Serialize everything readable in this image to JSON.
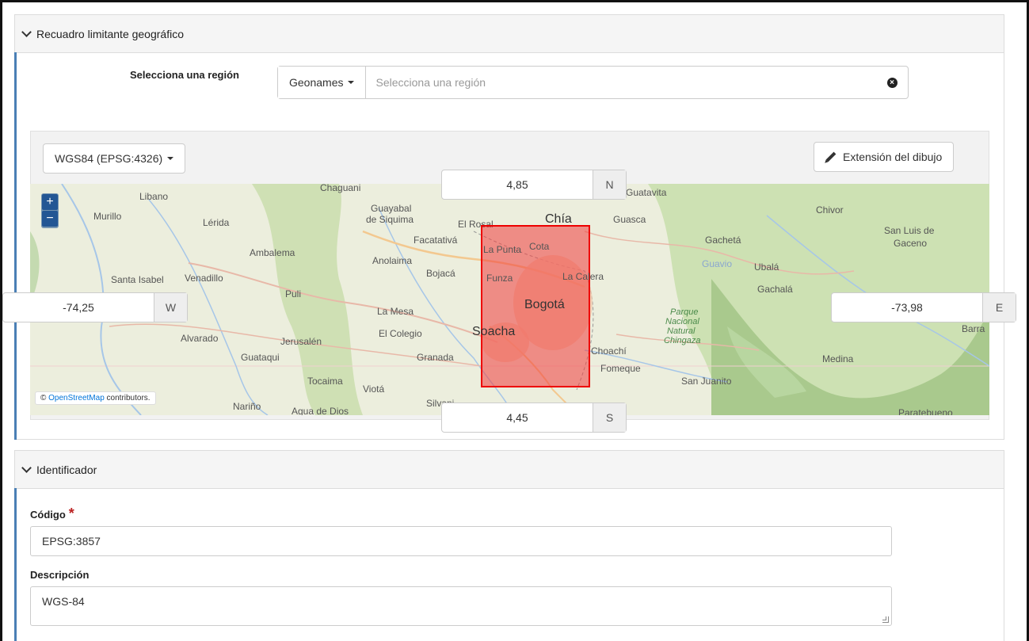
{
  "bbox_section": {
    "title": "Recuadro limitante geográfico",
    "region_label": "Selecciona una región",
    "geonames_button": "Geonames",
    "region_placeholder": "Selecciona una región",
    "crs_button": "WGS84 (EPSG:4326)",
    "draw_extent_button": "Extensión del dibujo",
    "north": {
      "value": "4,85",
      "addon": "N"
    },
    "south": {
      "value": "4,45",
      "addon": "S"
    },
    "west": {
      "value": "-74,25",
      "addon": "W"
    },
    "east": {
      "value": "-73,98",
      "addon": "E"
    },
    "map": {
      "zoom_in": "+",
      "zoom_out": "−",
      "attribution_prefix": "©",
      "attribution_link": "OpenStreetMap",
      "attribution_suffix": "contributors.",
      "labels": {
        "libano": "Libano",
        "murillo": "Murillo",
        "lerida": "Lérida",
        "ambalema": "Ambalema",
        "santa_isabel": "Santa Isabel",
        "venadillo": "Venadillo",
        "chaguani": "Chaguani",
        "guayabal": "Guayabal",
        "de_siquima": "de Siquima",
        "facatativa": "Facatativá",
        "anolaima": "Anolaima",
        "bojaca": "Bojacá",
        "puli": "Puli",
        "la_mesa": "La Mesa",
        "el_colegio": "El Colegio",
        "alvarado": "Alvarado",
        "jerusalen": "Jerusalén",
        "guataqui": "Guataqui",
        "granada": "Granada",
        "tocaima": "Tocaima",
        "viota": "Viotá",
        "narino": "Nariño",
        "agua_de_dios": "Agua de Dios",
        "silvania": "Silvani",
        "el_rosal": "El Rosal",
        "chia": "Chía",
        "cota": "Cota",
        "la_punta": "La Punta",
        "funza": "Funza",
        "bogota": "Bogotá",
        "soacha": "Soacha",
        "la_calera": "La Calera",
        "guatavita": "Guatavita",
        "guasca": "Guasca",
        "gacheta": "Gachetá",
        "guavio": "Guavio",
        "ubala": "Ubalá",
        "gachala": "Gachalá",
        "chivor": "Chivor",
        "san_luis": "San Luis de",
        "gaceno": "Gaceno",
        "choachi": "Choachí",
        "fomeque": "Fomeque",
        "medina": "Medina",
        "san_juanito": "San Juanito",
        "parque1": "Parque",
        "parque2": "Nacional",
        "parque3": "Natural",
        "parque4": "Chingaza",
        "barra": "Barra",
        "paratebueno": "Paratebueno"
      }
    }
  },
  "identifier_section": {
    "title": "Identificador",
    "code_label": "Código",
    "code_required": "*",
    "code_value": "EPSG:3857",
    "description_label": "Descripción",
    "description_value": "WGS-84"
  }
}
